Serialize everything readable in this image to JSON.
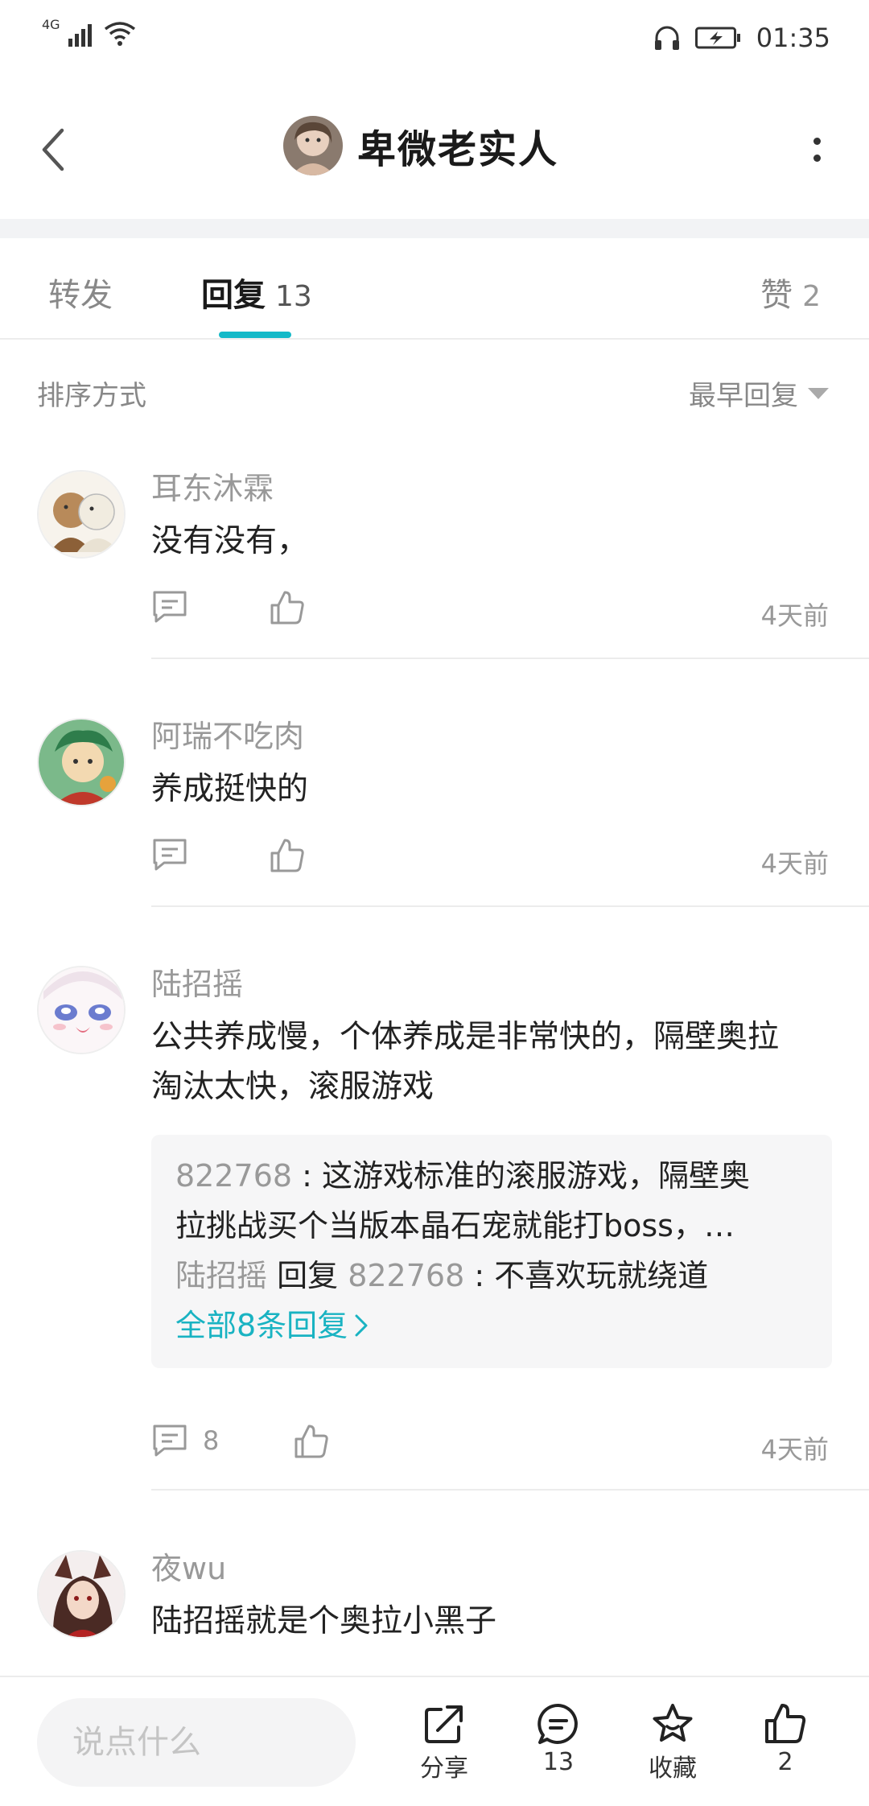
{
  "status_bar": {
    "network": "4G",
    "time": "01:35"
  },
  "header": {
    "title": "卑微老实人"
  },
  "tabs": {
    "forward": {
      "label": "转发"
    },
    "reply": {
      "label": "回复",
      "count": "13"
    },
    "like": {
      "label": "赞",
      "count": "2"
    }
  },
  "sort": {
    "label": "排序方式",
    "selected": "最早回复"
  },
  "comments": [
    {
      "name": "耳东沐霖",
      "text": "没有没有，",
      "time": "4天前"
    },
    {
      "name": "阿瑞不吃肉",
      "text": "养成挺快的",
      "time": "4天前"
    },
    {
      "name": "陆招摇",
      "text_line1": "公共养成慢，个体养成是非常快的，隔壁奥拉",
      "text_line2": "淘汰太快，滚服游戏",
      "replies": {
        "r1_user": "822768",
        "r1_sep": " : ",
        "r1_line1": "这游戏标准的滚服游戏，隔壁奥",
        "r1_line2": "拉挑战买个当版本晶石宠就能打boss，…",
        "r2_user": "陆招摇",
        "r2_mid": " 回复 ",
        "r2_target": "822768",
        "r2_sep": " : ",
        "r2_text": "不喜欢玩就绕道",
        "more": "全部8条回复"
      },
      "reply_count": "8",
      "time": "4天前"
    },
    {
      "name": "夜wu",
      "text": "陆招摇就是个奥拉小黑子"
    }
  ],
  "bottom_bar": {
    "input_placeholder": "说点什么",
    "share_label": "分享",
    "comment_count": "13",
    "favorite_label": "收藏",
    "like_count": "2"
  },
  "colors": {
    "accent": "#14b9c8",
    "link": "#19b3c2",
    "muted_text": "#999999"
  }
}
